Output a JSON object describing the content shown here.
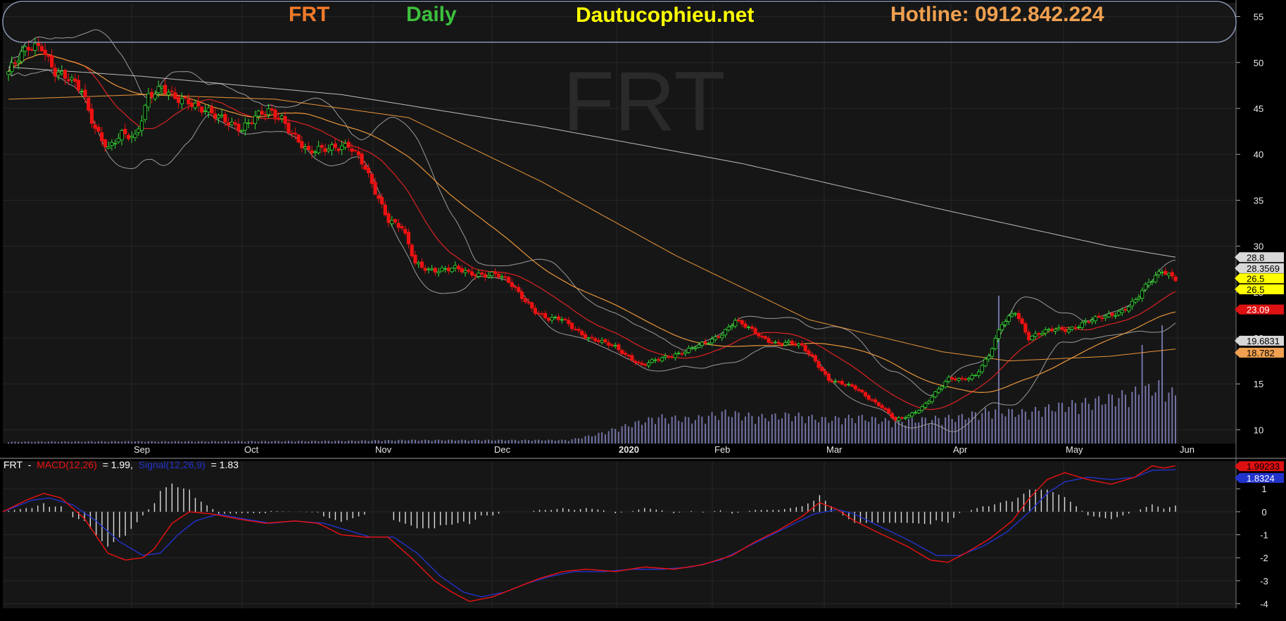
{
  "header": {
    "symbol": "FRT",
    "period": "Daily",
    "site": "Dautucophieu.net",
    "hotline": "Hotline: 0912.842.224",
    "watermark": "FRT"
  },
  "colors": {
    "up": "#33dd33",
    "down": "#ee1111",
    "ma_fast": "#dd2222",
    "ma_mid": "#e8953a",
    "ma_slow": "#bbbbbb",
    "band": "#9a9a9a",
    "volume": "#7373a8",
    "macd": "#ee1111",
    "signal": "#2233cc",
    "hist": "#dddddd"
  },
  "chart_data": [
    {
      "type": "candlestick",
      "title": "FRT Daily",
      "x_months": [
        "Sep",
        "Oct",
        "Nov",
        "Dec",
        "2020",
        "Feb",
        "Mar",
        "Apr",
        "May",
        "Jun"
      ],
      "y_ticks": [
        55,
        50,
        45,
        40,
        35,
        30,
        25,
        20,
        15,
        10
      ],
      "ylim": [
        8.5,
        56.5
      ],
      "price_tags": [
        {
          "value": "28.8",
          "level": 28.8,
          "bg": "#d8d8d8",
          "fg": "#000000"
        },
        {
          "value": "28.3569",
          "level": 27.6,
          "bg": "#d8d8d8",
          "fg": "#000000"
        },
        {
          "value": "26.5",
          "level": 26.5,
          "bg": "#ffff00",
          "fg": "#000000"
        },
        {
          "value": "26.5",
          "level": 25.3,
          "bg": "#ffff00",
          "fg": "#000000"
        },
        {
          "value": "23.09",
          "level": 23.1,
          "bg": "#dd1111",
          "fg": "#ffffff"
        },
        {
          "value": "19.6831",
          "level": 19.7,
          "bg": "#d8d8d8",
          "fg": "#000000"
        },
        {
          "value": "18.782",
          "level": 18.4,
          "bg": "#f0a050",
          "fg": "#000000"
        }
      ],
      "close_waypoints": [
        [
          0,
          49
        ],
        [
          6,
          51.5
        ],
        [
          10,
          52
        ],
        [
          14,
          49
        ],
        [
          18,
          48
        ],
        [
          22,
          47
        ],
        [
          26,
          43
        ],
        [
          30,
          40.5
        ],
        [
          34,
          42
        ],
        [
          38,
          42
        ],
        [
          42,
          46.5
        ],
        [
          46,
          47
        ],
        [
          50,
          46
        ],
        [
          54,
          46
        ],
        [
          58,
          45
        ],
        [
          62,
          44
        ],
        [
          66,
          43.5
        ],
        [
          70,
          43
        ],
        [
          74,
          44
        ],
        [
          78,
          44.5
        ],
        [
          82,
          44
        ],
        [
          86,
          42
        ],
        [
          90,
          40
        ],
        [
          94,
          40.5
        ],
        [
          98,
          41
        ],
        [
          102,
          41
        ],
        [
          106,
          39
        ],
        [
          110,
          36
        ],
        [
          114,
          33
        ],
        [
          118,
          32
        ],
        [
          122,
          28
        ],
        [
          126,
          27.5
        ],
        [
          130,
          27.5
        ],
        [
          134,
          27.5
        ],
        [
          138,
          27
        ],
        [
          142,
          27
        ],
        [
          146,
          27
        ],
        [
          150,
          26
        ],
        [
          154,
          24.5
        ],
        [
          158,
          23
        ],
        [
          162,
          22
        ],
        [
          166,
          22
        ],
        [
          170,
          21
        ],
        [
          174,
          20
        ],
        [
          178,
          19.5
        ],
        [
          182,
          19
        ],
        [
          186,
          18
        ],
        [
          190,
          17
        ],
        [
          194,
          17.5
        ],
        [
          198,
          18
        ],
        [
          202,
          18.5
        ],
        [
          206,
          19
        ],
        [
          210,
          19.5
        ],
        [
          214,
          20.5
        ],
        [
          218,
          22
        ],
        [
          222,
          21
        ],
        [
          226,
          20
        ],
        [
          230,
          19.5
        ],
        [
          234,
          19.5
        ],
        [
          238,
          19
        ],
        [
          242,
          17.5
        ],
        [
          246,
          15.5
        ],
        [
          250,
          15
        ],
        [
          254,
          14.5
        ],
        [
          258,
          13.5
        ],
        [
          262,
          12.5
        ],
        [
          266,
          11
        ],
        [
          270,
          11.5
        ],
        [
          274,
          12.5
        ],
        [
          278,
          14
        ],
        [
          282,
          15.5
        ],
        [
          286,
          15.5
        ],
        [
          290,
          16
        ],
        [
          294,
          18
        ],
        [
          298,
          21.5
        ],
        [
          302,
          23
        ],
        [
          306,
          20
        ],
        [
          310,
          20.5
        ],
        [
          314,
          21
        ],
        [
          318,
          21
        ],
        [
          322,
          21.5
        ],
        [
          326,
          22
        ],
        [
          330,
          22.5
        ],
        [
          334,
          23
        ],
        [
          338,
          24
        ],
        [
          342,
          26
        ],
        [
          346,
          27.5
        ],
        [
          350,
          26.5
        ]
      ],
      "volume_waypoints": [
        [
          0,
          0.04
        ],
        [
          30,
          0.05
        ],
        [
          60,
          0.05
        ],
        [
          100,
          0.06
        ],
        [
          120,
          0.08
        ],
        [
          150,
          0.08
        ],
        [
          168,
          0.08
        ],
        [
          176,
          0.2
        ],
        [
          185,
          0.4
        ],
        [
          195,
          0.6
        ],
        [
          205,
          0.55
        ],
        [
          215,
          0.7
        ],
        [
          225,
          0.6
        ],
        [
          235,
          0.65
        ],
        [
          245,
          0.55
        ],
        [
          255,
          0.6
        ],
        [
          265,
          0.5
        ],
        [
          275,
          0.55
        ],
        [
          285,
          0.6
        ],
        [
          295,
          0.75
        ],
        [
          305,
          0.7
        ],
        [
          315,
          0.85
        ],
        [
          325,
          0.95
        ],
        [
          335,
          1.1
        ],
        [
          345,
          1.3
        ],
        [
          350,
          1.1
        ]
      ],
      "volume_spikes": [
        [
          297,
          3.0
        ],
        [
          340,
          2.0
        ],
        [
          346,
          2.4
        ]
      ]
    },
    {
      "type": "line",
      "title": "MACD",
      "legend": {
        "symbol": "FRT",
        "dash": "-",
        "macd_name": "MACD(12,26)",
        "macd_eq": "= 1.99,",
        "signal_name": "Signal(12,26,9)",
        "signal_eq": "= 1.83"
      },
      "y_ticks": [
        1,
        0,
        -1,
        -2,
        -3,
        -4
      ],
      "ylim": [
        -4.2,
        2.2
      ],
      "tags": [
        {
          "value": "1.99233",
          "level": 1.98,
          "bg": "#dd1111",
          "fg": "#000000"
        },
        {
          "value": "1.8324",
          "level": 1.47,
          "bg": "#2233cc",
          "fg": "#ffffff"
        }
      ],
      "macd_waypoints": [
        [
          0,
          0
        ],
        [
          8,
          0.5
        ],
        [
          14,
          0.8
        ],
        [
          20,
          0.6
        ],
        [
          28,
          -0.3
        ],
        [
          36,
          -1.8
        ],
        [
          42,
          -2.1
        ],
        [
          48,
          -2.0
        ],
        [
          52,
          -1.6
        ],
        [
          58,
          -0.5
        ],
        [
          64,
          0
        ],
        [
          72,
          -0.1
        ],
        [
          80,
          -0.3
        ],
        [
          90,
          -0.5
        ],
        [
          100,
          -0.4
        ],
        [
          108,
          -0.5
        ],
        [
          116,
          -1.0
        ],
        [
          124,
          -1.1
        ],
        [
          132,
          -1.1
        ],
        [
          140,
          -2.0
        ],
        [
          148,
          -3.0
        ],
        [
          154,
          -3.5
        ],
        [
          160,
          -3.9
        ],
        [
          168,
          -3.7
        ],
        [
          176,
          -3.3
        ],
        [
          184,
          -2.9
        ],
        [
          192,
          -2.6
        ],
        [
          200,
          -2.5
        ],
        [
          210,
          -2.6
        ],
        [
          220,
          -2.4
        ],
        [
          230,
          -2.5
        ],
        [
          240,
          -2.3
        ],
        [
          250,
          -1.9
        ],
        [
          258,
          -1.3
        ],
        [
          266,
          -0.8
        ],
        [
          274,
          -0.2
        ],
        [
          280,
          0.4
        ],
        [
          286,
          0.1
        ],
        [
          292,
          -0.4
        ],
        [
          300,
          -0.9
        ],
        [
          310,
          -1.5
        ],
        [
          318,
          -2.1
        ],
        [
          324,
          -2.2
        ],
        [
          330,
          -1.8
        ],
        [
          338,
          -1.2
        ],
        [
          346,
          -0.4
        ],
        [
          352,
          0.6
        ],
        [
          358,
          1.4
        ],
        [
          364,
          1.7
        ],
        [
          372,
          1.4
        ],
        [
          380,
          1.2
        ],
        [
          388,
          1.5
        ],
        [
          394,
          2.0
        ],
        [
          398,
          1.9
        ],
        [
          402,
          2.0
        ]
      ],
      "signal_waypoints": [
        [
          0,
          0
        ],
        [
          10,
          0.5
        ],
        [
          16,
          0.6
        ],
        [
          24,
          0.3
        ],
        [
          32,
          -0.4
        ],
        [
          40,
          -1.3
        ],
        [
          48,
          -1.9
        ],
        [
          54,
          -1.8
        ],
        [
          60,
          -1.0
        ],
        [
          66,
          -0.4
        ],
        [
          74,
          -0.1
        ],
        [
          82,
          -0.3
        ],
        [
          92,
          -0.5
        ],
        [
          100,
          -0.4
        ],
        [
          110,
          -0.5
        ],
        [
          118,
          -0.8
        ],
        [
          126,
          -1.1
        ],
        [
          134,
          -1.1
        ],
        [
          142,
          -1.8
        ],
        [
          150,
          -2.8
        ],
        [
          158,
          -3.5
        ],
        [
          164,
          -3.7
        ],
        [
          172,
          -3.5
        ],
        [
          180,
          -3.1
        ],
        [
          188,
          -2.8
        ],
        [
          196,
          -2.6
        ],
        [
          206,
          -2.6
        ],
        [
          216,
          -2.5
        ],
        [
          226,
          -2.5
        ],
        [
          236,
          -2.4
        ],
        [
          246,
          -2.1
        ],
        [
          254,
          -1.6
        ],
        [
          262,
          -1.1
        ],
        [
          270,
          -0.6
        ],
        [
          278,
          -0.1
        ],
        [
          286,
          0.1
        ],
        [
          292,
          -0.1
        ],
        [
          300,
          -0.6
        ],
        [
          310,
          -1.2
        ],
        [
          320,
          -1.9
        ],
        [
          328,
          -1.9
        ],
        [
          336,
          -1.5
        ],
        [
          344,
          -0.9
        ],
        [
          352,
          0.0
        ],
        [
          358,
          0.8
        ],
        [
          364,
          1.3
        ],
        [
          372,
          1.5
        ],
        [
          380,
          1.4
        ],
        [
          388,
          1.5
        ],
        [
          394,
          1.8
        ],
        [
          402,
          1.83
        ]
      ]
    }
  ]
}
